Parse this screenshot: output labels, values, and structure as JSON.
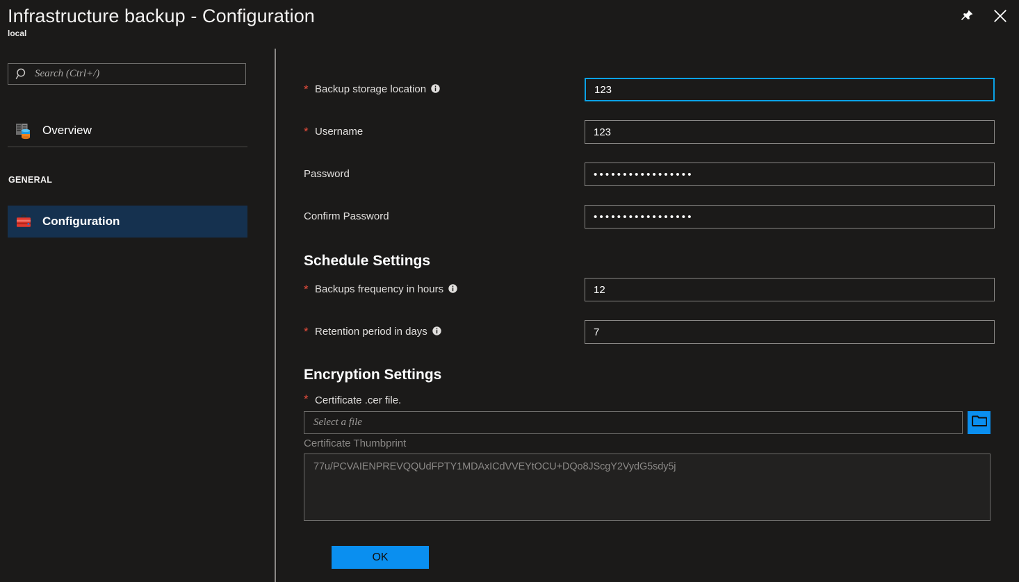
{
  "window": {
    "title": "Infrastructure backup - Configuration",
    "subtitle": "local",
    "pin_icon": "pin-icon",
    "close_icon": "close-icon"
  },
  "sidebar": {
    "search": {
      "placeholder": "Search (Ctrl+/)",
      "icon": "search-icon",
      "value": ""
    },
    "items": [
      {
        "label": "Overview",
        "icon": "server-overview-icon",
        "selected": false
      },
      {
        "label": "Configuration",
        "icon": "toolbox-icon",
        "selected": true
      }
    ],
    "group_label": "GENERAL"
  },
  "form": {
    "fields": [
      {
        "label": "Backup storage location",
        "required": true,
        "info": true,
        "value": "123",
        "focused": true,
        "type": "text"
      },
      {
        "label": "Username",
        "required": true,
        "info": false,
        "value": "123",
        "focused": false,
        "type": "text"
      },
      {
        "label": "Password",
        "required": false,
        "info": false,
        "value": "•••••••••••••••••",
        "focused": false,
        "type": "password"
      },
      {
        "label": "Confirm Password",
        "required": false,
        "info": false,
        "value": "•••••••••••••••••",
        "focused": false,
        "type": "password"
      }
    ],
    "schedule": {
      "title": "Schedule Settings",
      "fields": [
        {
          "label": "Backups frequency in hours",
          "required": true,
          "info": true,
          "value": "12"
        },
        {
          "label": "Retention period in days",
          "required": true,
          "info": true,
          "value": "7"
        }
      ]
    },
    "encryption": {
      "title": "Encryption Settings",
      "file_label": "Certificate .cer file.",
      "file_required": true,
      "file_placeholder": "Select a file",
      "file_value": "",
      "browse_icon": "folder-icon",
      "thumbprint_label": "Certificate Thumbprint",
      "thumbprint_value": "77u/PCVAIENPREVQQUdFPTY1MDAxICdVVEYtOCU+DQo8JScgY2VydG5sdy5j"
    },
    "ok_label": "OK"
  },
  "colors": {
    "accent": "#0a8ff0",
    "focus_border": "#0aa2e6",
    "required": "#e74c3c",
    "selected_nav": "#15314f",
    "background": "#1b1a19"
  }
}
